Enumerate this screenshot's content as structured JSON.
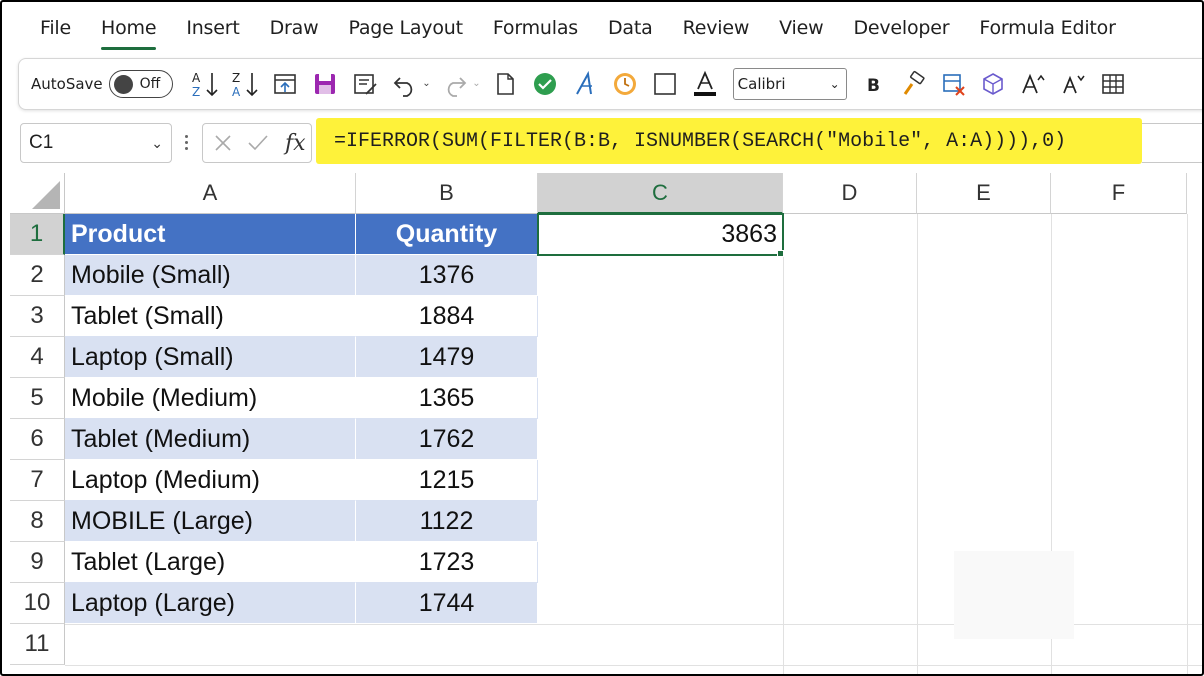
{
  "menu": {
    "items": [
      "File",
      "Home",
      "Insert",
      "Draw",
      "Page Layout",
      "Formulas",
      "Data",
      "Review",
      "View",
      "Developer",
      "Formula Editor"
    ],
    "active": "Home"
  },
  "ribbon": {
    "autosave_label": "AutoSave",
    "autosave_state": "Off",
    "font_name": "Calibri",
    "icons": [
      "sort-ascending-icon",
      "sort-descending-icon",
      "freeze-panes-icon",
      "save-icon",
      "form-icon",
      "undo-icon",
      "redo-icon",
      "new-file-icon",
      "check-circle-icon",
      "italic-a-icon",
      "clock-icon",
      "border-icon",
      "font-color-icon",
      "bold-icon",
      "format-painter-icon",
      "clear-format-icon",
      "3d-model-icon",
      "increase-font-icon",
      "decrease-font-icon",
      "table-icon"
    ],
    "accent_color": "#1e6e3e"
  },
  "formula_bar": {
    "name_box": "C1",
    "formula": "=IFERROR(SUM(FILTER(B:B, ISNUMBER(SEARCH(\"Mobile\", A:A)))),0)",
    "highlight_color": "#fef23a"
  },
  "sheet": {
    "columns": [
      "A",
      "B",
      "C",
      "D",
      "E",
      "F"
    ],
    "selected_column": "C",
    "selected_row": "1",
    "rows": [
      "1",
      "2",
      "3",
      "4",
      "5",
      "6",
      "7",
      "8",
      "9",
      "10",
      "11"
    ],
    "table_header": {
      "product": "Product",
      "quantity": "Quantity"
    },
    "table_rows": [
      {
        "product": "Mobile (Small)",
        "quantity": "1376"
      },
      {
        "product": "Tablet (Small)",
        "quantity": "1884"
      },
      {
        "product": "Laptop (Small)",
        "quantity": "1479"
      },
      {
        "product": "Mobile (Medium)",
        "quantity": "1365"
      },
      {
        "product": "Tablet (Medium)",
        "quantity": "1762"
      },
      {
        "product": "Laptop (Medium)",
        "quantity": "1215"
      },
      {
        "product": "MOBILE (Large)",
        "quantity": "1122"
      },
      {
        "product": "Tablet (Large)",
        "quantity": "1723"
      },
      {
        "product": "Laptop (Large)",
        "quantity": "1744"
      }
    ],
    "result_cell": {
      "address": "C1",
      "value": "3863"
    },
    "header_fill": "#4472c4",
    "band_fill": "#d9e1f2"
  }
}
